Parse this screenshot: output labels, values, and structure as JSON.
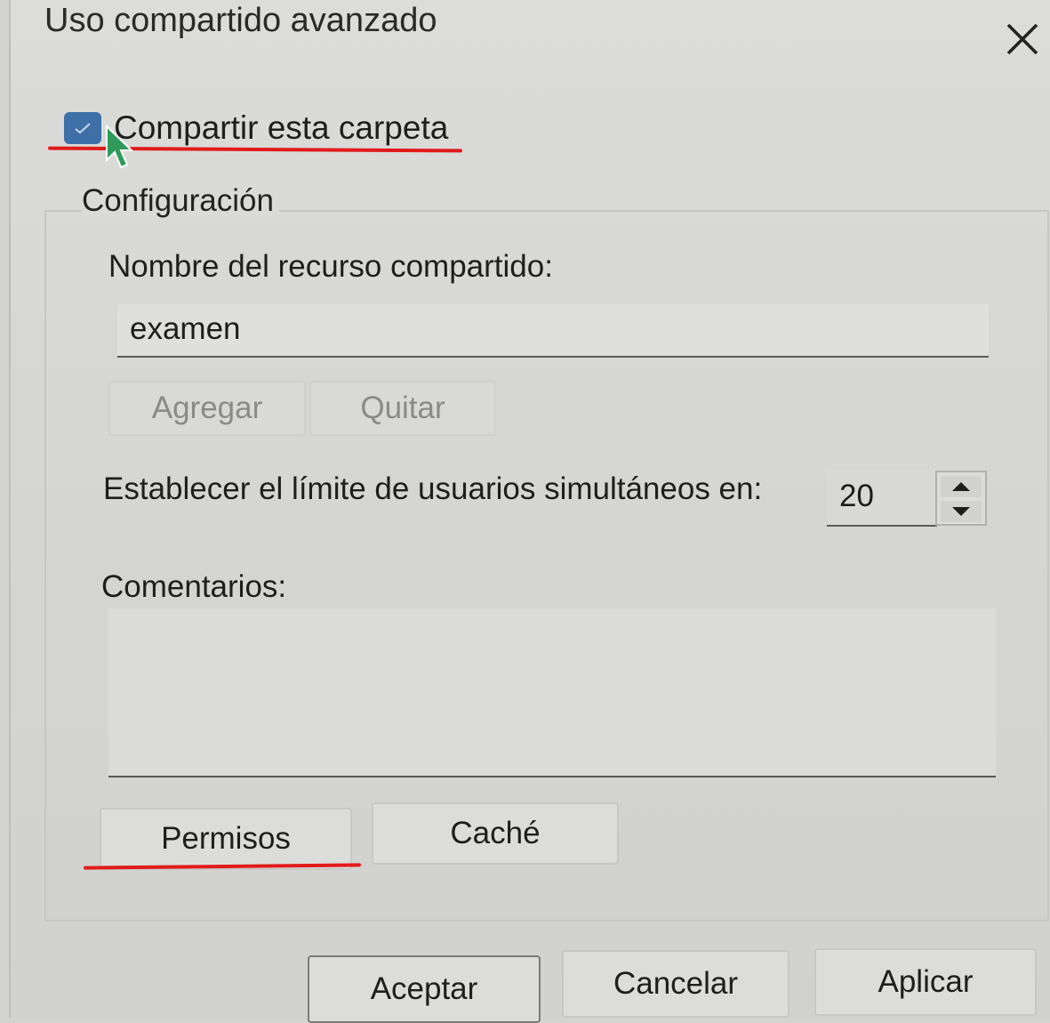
{
  "dialog": {
    "title": "Uso compartido avanzado",
    "close_icon": "close-icon"
  },
  "share_checkbox": {
    "label": "Compartir esta carpeta",
    "checked": true,
    "color": "#3e6fa6"
  },
  "settings": {
    "legend": "Configuración",
    "share_name_label": "Nombre del recurso compartido:",
    "share_name_value": "examen",
    "add_button": "Agregar",
    "remove_button": "Quitar",
    "user_limit_label": "Establecer el límite de usuarios simultáneos en:",
    "user_limit_value": "20",
    "comments_label": "Comentarios:",
    "comments_value": "",
    "permissions_button": "Permisos",
    "cache_button": "Caché"
  },
  "footer": {
    "ok_button": "Aceptar",
    "cancel_button": "Cancelar",
    "apply_button": "Aplicar"
  },
  "annotations": {
    "underline_color": "#e11b1b"
  }
}
